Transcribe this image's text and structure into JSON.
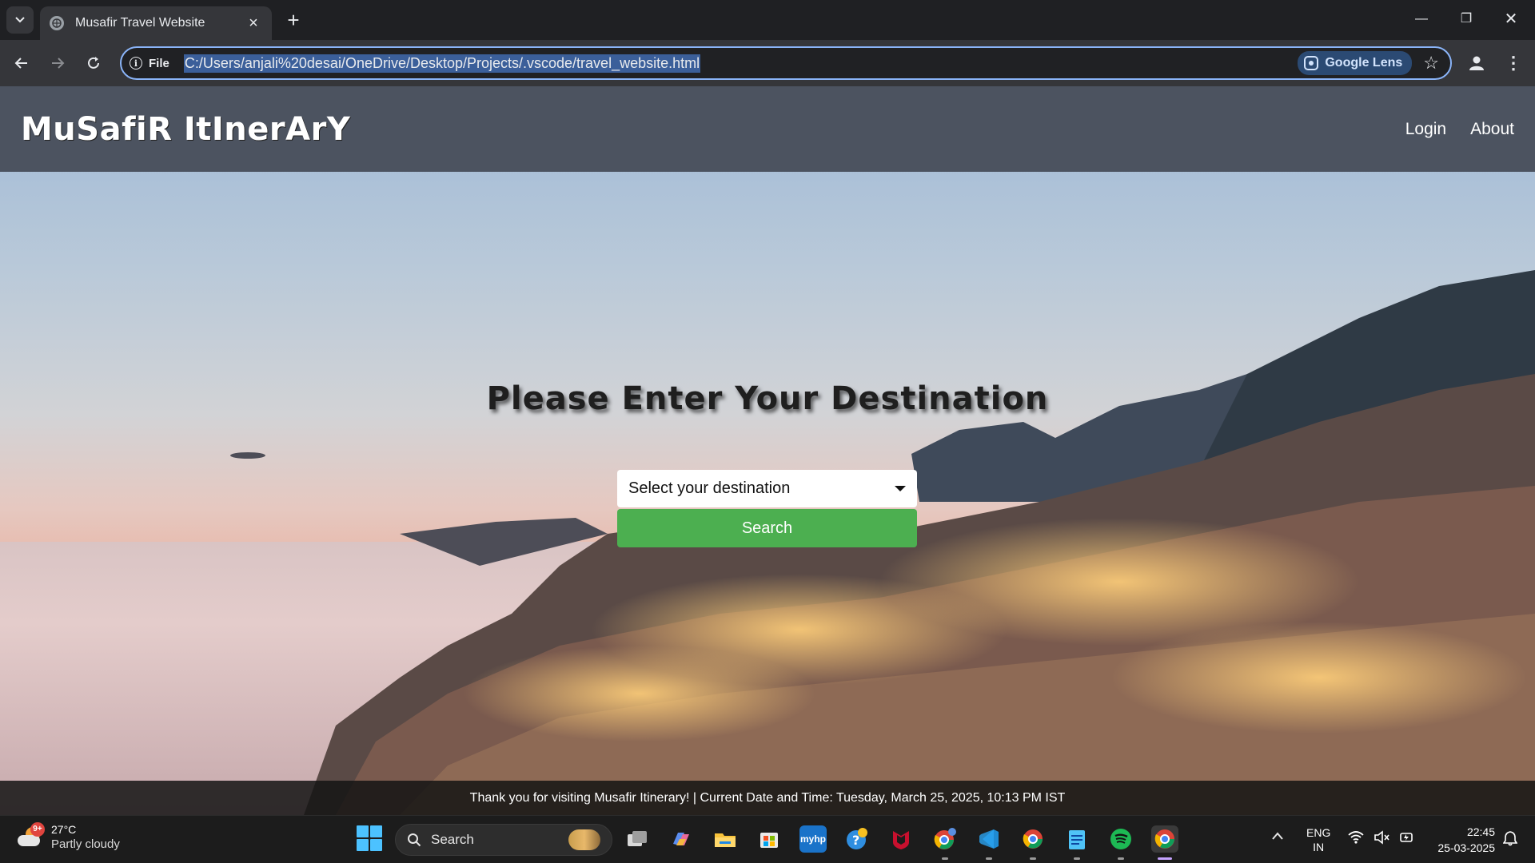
{
  "browser": {
    "tab_title": "Musafir Travel Website",
    "site_chip_label": "File",
    "url": "C:/Users/anjali%20desai/OneDrive/Desktop/Projects/.vscode/travel_website.html",
    "lens_label": "Google Lens",
    "icons": [
      "tab-search-icon",
      "globe-icon",
      "close-icon",
      "plus-icon",
      "minimize-icon",
      "restore-icon",
      "window-close-icon",
      "back-arrow-icon",
      "forward-arrow-icon",
      "reload-icon",
      "info-icon",
      "lens-icon",
      "star-icon",
      "profile-icon",
      "kebab-menu-icon"
    ]
  },
  "site": {
    "logo": "MuSafiR ItInerArY",
    "nav": [
      {
        "label": "Login"
      },
      {
        "label": "About"
      }
    ],
    "headline": "Please Enter Your Destination",
    "select": {
      "selected": "Select your destination"
    },
    "search_button": "Search",
    "footer_text": "Thank you for visiting Musafir Itinerary! | Current Date and Time: Tuesday, March 25, 2025, 10:13 PM IST",
    "colors": {
      "header_bg": "#4c5360",
      "search_button": "#4caf50"
    }
  },
  "taskbar": {
    "weather": {
      "temp": "27°C",
      "desc": "Partly cloudy",
      "badge": "9+"
    },
    "search_label": "Search",
    "apps": [
      "task-view",
      "copilot",
      "file-explorer",
      "microsoft-store",
      "myhp",
      "get-help",
      "mcafee",
      "chrome-profile",
      "vscode",
      "chrome",
      "notepad",
      "spotify",
      "chrome-active"
    ],
    "lang_top": "ENG",
    "lang_bottom": "IN",
    "time": "22:45",
    "date": "25-03-2025"
  }
}
